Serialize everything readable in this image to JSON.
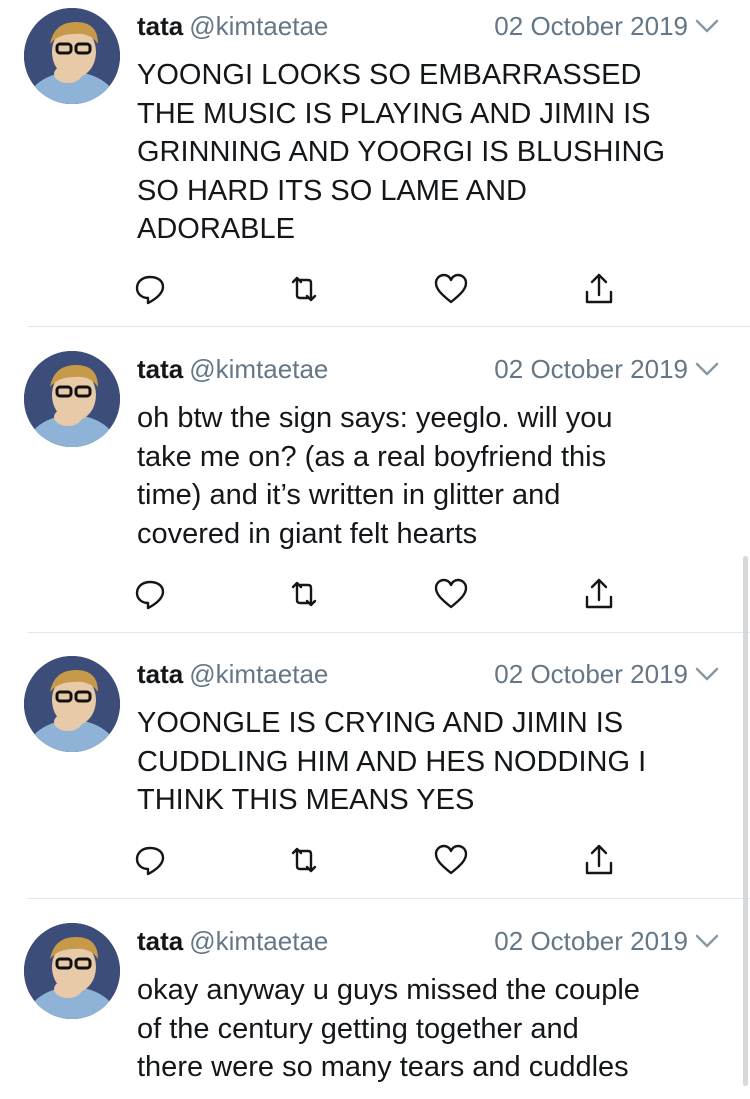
{
  "tweets": [
    {
      "name": "tata",
      "handle": "@kimtaetae",
      "date": "02 October 2019",
      "text": "YOONGI LOOKS SO EMBARRASSED THE MUSIC IS PLAYING AND JIMIN IS GRINNING AND YOORGI IS BLUSHING SO HARD ITS SO LAME AND ADORABLE",
      "lines": [
        "YOONGI LOOKS SO EMBARRASSED",
        "THE MUSIC IS PLAYING AND JIMIN IS",
        "GRINNING AND YOORGI IS BLUSHING",
        "SO HARD ITS SO LAME AND",
        "ADORABLE"
      ]
    },
    {
      "name": "tata",
      "handle": "@kimtaetae",
      "date": "02 October 2019",
      "text": "oh btw the sign says: yeeglo. will you take me on? (as a real boyfriend this time) and it’s written in glitter and covered in giant felt hearts",
      "lines": [
        "oh btw the sign says: yeeglo. will you",
        "take me on? (as a real boyfriend this",
        "time) and it’s written in glitter and",
        "covered in giant felt hearts"
      ]
    },
    {
      "name": "tata",
      "handle": "@kimtaetae",
      "date": "02 October 2019",
      "text": "YOONGLE IS CRYING AND JIMIN IS CUDDLING HIM AND HES NODDING I THINK THIS MEANS YES",
      "lines": [
        "YOONGLE IS CRYING AND JIMIN IS",
        "CUDDLING HIM AND HES NODDING I",
        "THINK THIS MEANS YES"
      ]
    },
    {
      "name": "tata",
      "handle": "@kimtaetae",
      "date": "02 October 2019",
      "text": "okay anyway u guys missed the couple of the century getting together and there were so many tears and cuddles",
      "lines": [
        "okay anyway u guys missed the couple",
        "of the century getting together and",
        "there were so many tears and cuddles"
      ]
    }
  ],
  "icons": {
    "reply": "reply-icon",
    "retweet": "retweet-icon",
    "like": "heart-icon",
    "share": "share-icon",
    "more": "chevron-down-icon"
  },
  "colors": {
    "text": "#14171a",
    "secondary": "#657786",
    "icon": "#657786",
    "divider": "#e1e8ed"
  }
}
